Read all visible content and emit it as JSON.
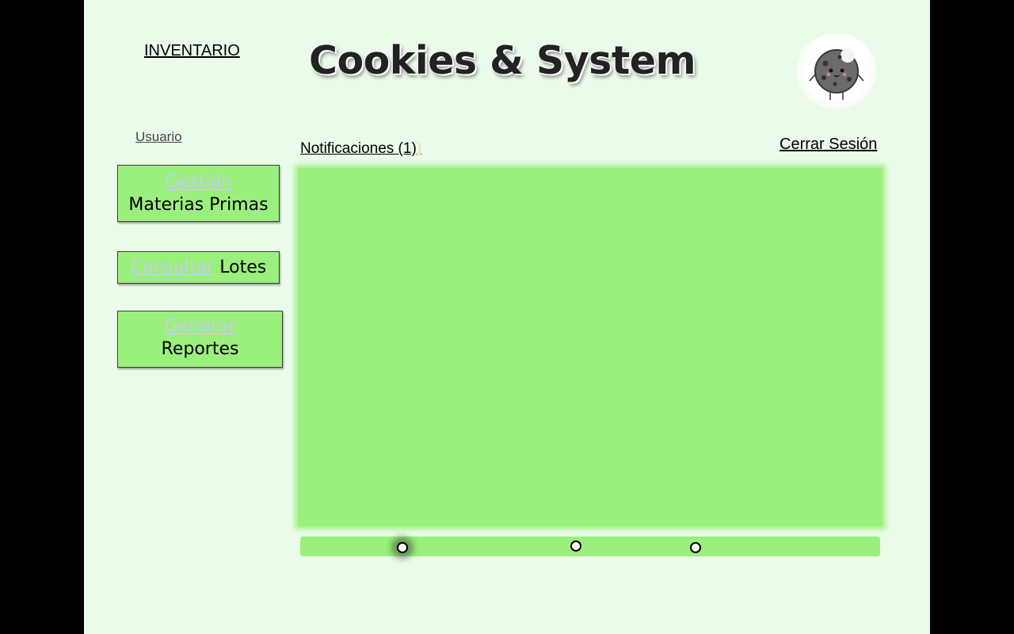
{
  "header": {
    "nav_inventario": "INVENTARIO",
    "title": "Cookies & System",
    "logo_icon": "cookie-mascot-icon"
  },
  "user": {
    "label": "Usuario",
    "notifications_label": "Notificaciones (1)",
    "notifications_mark": ")",
    "logout_label": "Cerrar Sesión"
  },
  "sidebar": {
    "items": [
      {
        "accent": "Gestión",
        "label": "Materias Primas"
      },
      {
        "accent": "Consultar",
        "label": "Lotes"
      },
      {
        "accent": "Generar",
        "label": "Reportes"
      }
    ]
  },
  "colors": {
    "background": "#eafbea",
    "accent_green": "#9bef7d",
    "link_accent": "#c9cdea"
  }
}
